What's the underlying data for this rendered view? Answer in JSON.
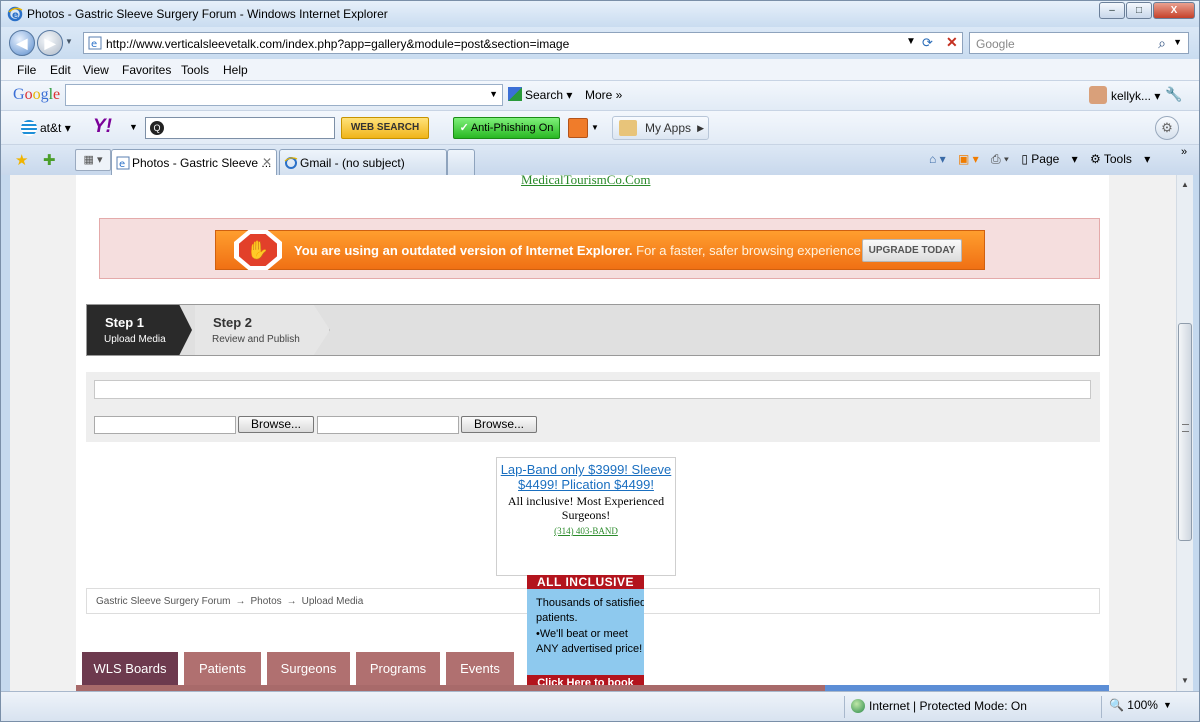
{
  "window": {
    "title": "Photos - Gastric Sleeve Surgery Forum - Windows Internet Explorer",
    "min_label": "–",
    "max_label": "□",
    "close_label": "X"
  },
  "address": {
    "url": "http://www.verticalsleevetalk.com/index.php?app=gallery&module=post&section=image",
    "search_placeholder": "Google"
  },
  "menu": [
    "File",
    "Edit",
    "View",
    "Favorites",
    "Tools",
    "Help"
  ],
  "google_bar": {
    "logo": "Google",
    "search_label": "Search",
    "more_label": "More",
    "user": "kellyk..."
  },
  "yahoo_bar": {
    "att_label": "at&t",
    "yahoo_logo": "Y!",
    "web_search_label": "WEB SEARCH",
    "anti_phishing_label": "Anti-Phishing On",
    "my_apps_label": "My Apps"
  },
  "tabs": [
    {
      "label": "Photos - Gastric Sleeve ...",
      "active": true
    },
    {
      "label": "Gmail - (no subject)",
      "active": false
    }
  ],
  "command_bar": {
    "page_label": "Page",
    "tools_label": "Tools"
  },
  "page": {
    "top_link": "MedicalTourismCo.Com",
    "ie_banner": {
      "bold_text": "You are using an outdated version of Internet Explorer.",
      "rest_text": " For a faster, safer browsing experience",
      "button": "UPGRADE TODAY"
    },
    "steps": [
      {
        "title": "Step 1",
        "sub": "Upload Media",
        "active": true
      },
      {
        "title": "Step 2",
        "sub": "Review and Publish",
        "active": false
      }
    ],
    "browse_label": "Browse...",
    "ad": {
      "link": "Lap-Band only $3999! Sleeve $4499! Plication $4499!",
      "text": "All inclusive! Most Experienced Surgeons!",
      "phone": "(314) 403-BAND"
    },
    "banner2": {
      "header": "ALL INCLUSIVE",
      "line1": "Thousands of satisfied",
      "line2": "patients.",
      "line3": "•We'll beat or meet",
      "line4": "ANY advertised price!",
      "footer": "Click Here to book now!"
    },
    "breadcrumb": [
      "Gastric Sleeve Surgery Forum",
      "Photos",
      "Upload Media"
    ],
    "breadcrumb_sep": "→",
    "nav_tabs": [
      "WLS Boards",
      "Patients",
      "Surgeons",
      "Programs",
      "Events"
    ]
  },
  "status_bar": {
    "zone": "Internet | Protected Mode: On",
    "zoom": "100%"
  },
  "colors": {
    "ie_banner_orange": "#f07014",
    "nav_active": "#6d3a4e",
    "nav_inactive": "#b07070",
    "link_blue": "#1a6fc0"
  }
}
